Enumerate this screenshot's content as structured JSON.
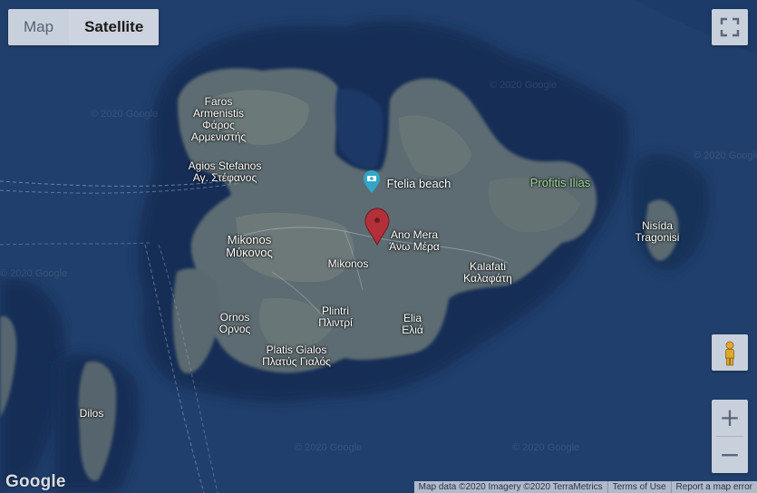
{
  "map_type": {
    "map_label": "Map",
    "satellite_label": "Satellite",
    "selected": "Satellite"
  },
  "watermark_text": "© 2020 Google",
  "places": {
    "faros": {
      "line1": "Faros",
      "line2": "Armenistis",
      "line3": "Φάρος",
      "line4": "Αρμενιστής"
    },
    "agios_stefanos": {
      "line1": "Agios Stefanos",
      "line2": "Αγ. Στέφανος"
    },
    "ftelia": {
      "label": "Ftelia beach"
    },
    "mikonos_town": {
      "line1": "Mikonos",
      "line2": "Μύκονος"
    },
    "ano_mera": {
      "line1": "Ano Mera",
      "line2": "Άνω Μέρα"
    },
    "mikonos_island": {
      "label": "Mikonos"
    },
    "kalafati": {
      "line1": "Kalafati",
      "line2": "Καλαφάτη"
    },
    "profitis_ilias": {
      "label": "Profitis Ilias"
    },
    "nisida": {
      "line1": "Nisída",
      "line2": "Tragonisi"
    },
    "ornos": {
      "line1": "Ornos",
      "line2": "Ορνος"
    },
    "plintri": {
      "line1": "Plintri",
      "line2": "Πλιντρί"
    },
    "elia": {
      "line1": "Elia",
      "line2": "Ελιά"
    },
    "platis_gialos": {
      "line1": "Platis Gialos",
      "line2": "Πλατύς Γιαλός"
    },
    "dilos": {
      "label": "Dilos"
    }
  },
  "markers": {
    "pin_color": "#b3303a",
    "poi_color": "#2fa7c9"
  },
  "controls": {
    "fullscreen_icon": "fullscreen-icon",
    "pegman_icon": "pegman-icon",
    "zoom_in": "+",
    "zoom_out": "−"
  },
  "footer": {
    "logo": "Google",
    "attribution": "Map data ©2020 Imagery ©2020 TerraMetrics",
    "terms": "Terms of Use",
    "report": "Report a map error"
  }
}
